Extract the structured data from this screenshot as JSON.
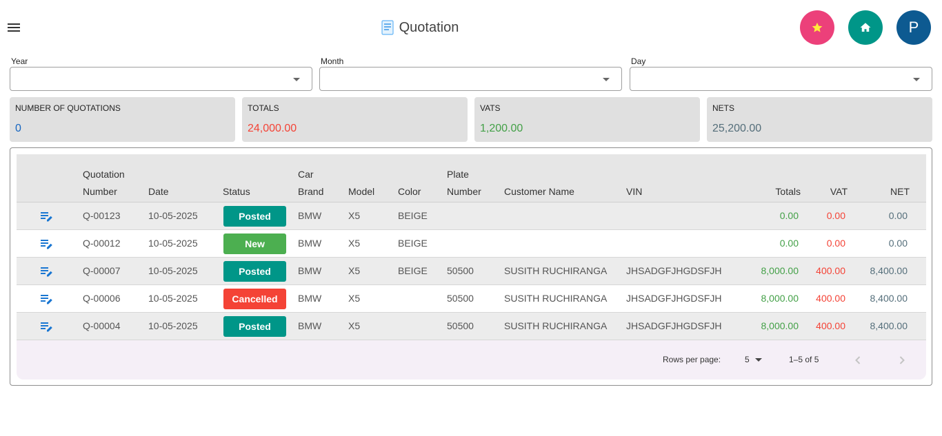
{
  "header": {
    "title": "Quotation",
    "avatar_initial": "P"
  },
  "filters": [
    {
      "label": "Year",
      "value": ""
    },
    {
      "label": "Month",
      "value": ""
    },
    {
      "label": "Day",
      "value": ""
    }
  ],
  "summary": [
    {
      "label": "NUMBER OF QUOTATIONS",
      "value": "0",
      "color": "#1565c0"
    },
    {
      "label": "TOTALS",
      "value": "24,000.00",
      "color": "#f44336"
    },
    {
      "label": "VATS",
      "value": "1,200.00",
      "color": "#43a047"
    },
    {
      "label": "NETS",
      "value": "25,200.00",
      "color": "#546e7a"
    }
  ],
  "table": {
    "headers": {
      "quotation_number_1": "Quotation",
      "quotation_number_2": "Number",
      "date": "Date",
      "status": "Status",
      "car_brand_1": "Car",
      "car_brand_2": "Brand",
      "model": "Model",
      "color": "Color",
      "plate_number_1": "Plate",
      "plate_number_2": "Number",
      "customer_name": "Customer Name",
      "vin": "VIN",
      "totals": "Totals",
      "vat": "VAT",
      "net": "NET"
    },
    "rows": [
      {
        "number": "Q-00123",
        "date": "10-05-2025",
        "status": "Posted",
        "status_color": "#009688",
        "brand": "BMW",
        "model": "X5",
        "color": "BEIGE",
        "plate": "",
        "customer": "",
        "vin": "",
        "totals": "0.00",
        "vat": "0.00",
        "net": "0.00"
      },
      {
        "number": "Q-00012",
        "date": "10-05-2025",
        "status": "New",
        "status_color": "#4caf50",
        "brand": "BMW",
        "model": "X5",
        "color": "BEIGE",
        "plate": "",
        "customer": "",
        "vin": "",
        "totals": "0.00",
        "vat": "0.00",
        "net": "0.00"
      },
      {
        "number": "Q-00007",
        "date": "10-05-2025",
        "status": "Posted",
        "status_color": "#009688",
        "brand": "BMW",
        "model": "X5",
        "color": "BEIGE",
        "plate": "50500",
        "customer": "SUSITH RUCHIRANGA",
        "vin": "JHSADGFJHGDSFJH",
        "totals": "8,000.00",
        "vat": "400.00",
        "net": "8,400.00"
      },
      {
        "number": "Q-00006",
        "date": "10-05-2025",
        "status": "Cancelled",
        "status_color": "#f44336",
        "brand": "BMW",
        "model": "X5",
        "color": "",
        "plate": "50500",
        "customer": "SUSITH RUCHIRANGA",
        "vin": "JHSADGFJHGDSFJH",
        "totals": "8,000.00",
        "vat": "400.00",
        "net": "8,400.00"
      },
      {
        "number": "Q-00004",
        "date": "10-05-2025",
        "status": "Posted",
        "status_color": "#009688",
        "brand": "BMW",
        "model": "X5",
        "color": "",
        "plate": "50500",
        "customer": "SUSITH RUCHIRANGA",
        "vin": "JHSADGFJHGDSFJH",
        "totals": "8,000.00",
        "vat": "400.00",
        "net": "8,400.00"
      }
    ],
    "value_colors": {
      "totals": "#43a047",
      "vat": "#f44336",
      "net": "#546e7a"
    }
  },
  "pagination": {
    "rows_per_page_label": "Rows per page:",
    "rows_per_page": "5",
    "range": "1–5 of 5"
  },
  "icons": {
    "menu": "menu-icon",
    "title": "receipt-icon",
    "favorite": "star-icon",
    "home": "home-icon",
    "edit": "edit-note-icon",
    "prev": "chevron-left-icon",
    "next": "chevron-right-icon"
  },
  "colors": {
    "favorite_bg": "#ec407a",
    "favorite_star": "#ffeb3b",
    "home_bg": "#009688",
    "avatar_bg": "#0d5a91",
    "edit_icon": "#1976d2"
  }
}
